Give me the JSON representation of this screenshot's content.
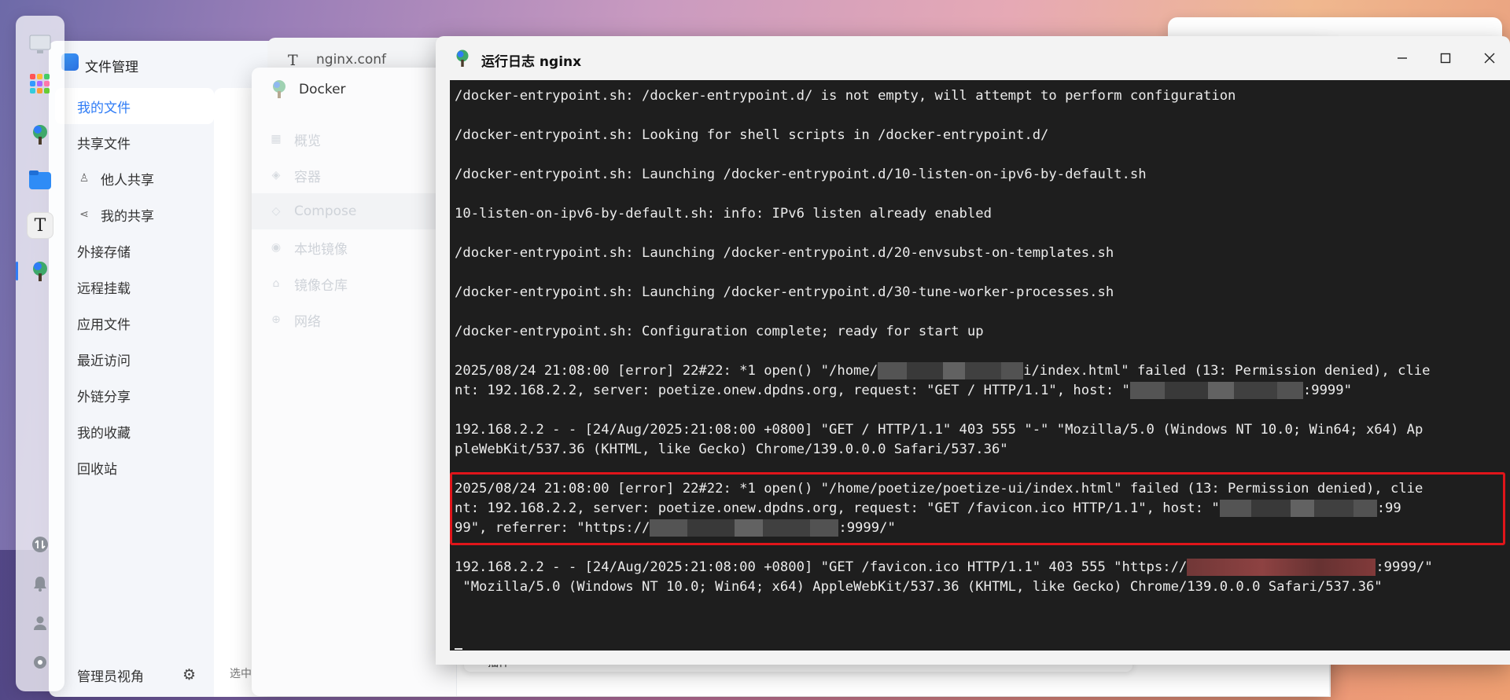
{
  "file_manager": {
    "title": "文件管理",
    "nav": [
      {
        "label": "我的文件",
        "icon": "folder-icon",
        "active": true
      },
      {
        "label": "共享文件",
        "icon": "share-icon"
      },
      {
        "label": "他人共享",
        "icon": "user-icon",
        "sub": true
      },
      {
        "label": "我的共享",
        "icon": "link-icon",
        "sub": true
      },
      {
        "label": "外接存储",
        "icon": "usb-icon"
      },
      {
        "label": "远程挂载",
        "icon": "cloud-icon"
      },
      {
        "label": "应用文件",
        "icon": "app-icon"
      },
      {
        "label": "最近访问",
        "icon": "clock-icon"
      },
      {
        "label": "外链分享",
        "icon": "link-icon"
      },
      {
        "label": "我的收藏",
        "icon": "star-icon"
      },
      {
        "label": "回收站",
        "icon": "trash-icon"
      }
    ],
    "admin_view": "管理员视角",
    "footer_text": "选中"
  },
  "editor_window": {
    "title": "nginx.conf"
  },
  "docker_window": {
    "title": "Docker",
    "nav": [
      "概览",
      "容器",
      "Compose",
      "本地镜像",
      "镜像仓库",
      "网络"
    ],
    "hint": "插件"
  },
  "log_window": {
    "title": "运行日志 nginx",
    "lines": [
      "/docker-entrypoint.sh: /docker-entrypoint.d/ is not empty, will attempt to perform configuration",
      "/docker-entrypoint.sh: Looking for shell scripts in /docker-entrypoint.d/",
      "/docker-entrypoint.sh: Launching /docker-entrypoint.d/10-listen-on-ipv6-by-default.sh",
      "10-listen-on-ipv6-by-default.sh: info: IPv6 listen already enabled",
      "/docker-entrypoint.sh: Launching /docker-entrypoint.d/20-envsubst-on-templates.sh",
      "/docker-entrypoint.sh: Launching /docker-entrypoint.d/30-tune-worker-processes.sh",
      "/docker-entrypoint.sh: Configuration complete; ready for start up"
    ],
    "err1_a": "2025/08/24 21:08:00 [error] 22#22: *1 open() \"/home/",
    "err1_b": "i/index.html\" failed (13: Permission denied), clie",
    "err1_c": "nt: 192.168.2.2, server: poetize.onew.dpdns.org, request: \"GET / HTTP/1.1\", host: \"",
    "err1_d": ":9999\"",
    "acc1_a": "192.168.2.2 - - [24/Aug/2025:21:08:00 +0800] \"GET / HTTP/1.1\" 403 555 \"-\" \"Mozilla/5.0 (Windows NT 10.0; Win64; x64) Ap",
    "acc1_b": "pleWebKit/537.36 (KHTML, like Gecko) Chrome/139.0.0.0 Safari/537.36\"",
    "err2_a": "2025/08/24 21:08:00 [error] 22#22: *1 open() \"/home/poetize/poetize-ui/index.html\" failed (13: Permission denied), clie",
    "err2_b": "nt: 192.168.2.2, server: poetize.onew.dpdns.org, request: \"GET /favicon.ico HTTP/1.1\", host: \"",
    "err2_b2": ":99",
    "err2_c": "99\", referrer: \"https://",
    "err2_c2": ":9999/\"",
    "acc2_a": "192.168.2.2 - - [24/Aug/2025:21:08:00 +0800] \"GET /favicon.ico HTTP/1.1\" 403 555 \"https://",
    "acc2_a2": ":9999/\"",
    "acc2_b": " \"Mozilla/5.0 (Windows NT 10.0; Win64; x64) AppleWebKit/537.36 (KHTML, like Gecko) Chrome/139.0.0.0 Safari/537.36\"",
    "highlight_color": "#e0151a"
  },
  "colors": {
    "accent": "#2f7cf6",
    "terminal_bg": "#1e1e1e"
  }
}
